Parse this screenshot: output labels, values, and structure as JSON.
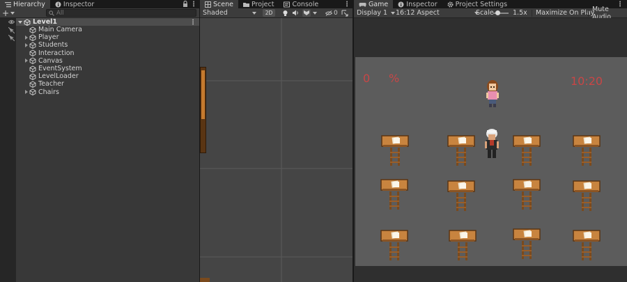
{
  "hierarchy": {
    "tabs": [
      {
        "label": "Hierarchy",
        "active": true
      },
      {
        "label": "Inspector",
        "active": false
      }
    ],
    "search_placeholder": "All",
    "root": "Level1",
    "items": [
      {
        "label": "Main Camera",
        "expandable": false
      },
      {
        "label": "Player",
        "expandable": true
      },
      {
        "label": "Students",
        "expandable": true
      },
      {
        "label": "Interaction",
        "expandable": false
      },
      {
        "label": "Canvas",
        "expandable": true
      },
      {
        "label": "EventSystem",
        "expandable": false
      },
      {
        "label": "LevelLoader",
        "expandable": false
      },
      {
        "label": "Teacher",
        "expandable": false
      },
      {
        "label": "Chairs",
        "expandable": true
      }
    ]
  },
  "scene": {
    "tabs": [
      {
        "label": "Scene",
        "active": true
      },
      {
        "label": "Project",
        "active": false
      },
      {
        "label": "Console",
        "active": false
      }
    ],
    "shading_mode": "Shaded",
    "mode_2d_label": "2D",
    "hidden_count": "0"
  },
  "game": {
    "tabs": [
      {
        "label": "Game",
        "active": true
      },
      {
        "label": "Inspector",
        "active": false
      },
      {
        "label": "Project Settings",
        "active": false
      }
    ],
    "display": "Display 1",
    "aspect": "16:12 Aspect",
    "scale_label": "Scale",
    "scale_value": "1.5x",
    "maximize_label": "Maximize On Play",
    "mute_label": "Mute Audio",
    "hud": {
      "score": "0",
      "percent": "%",
      "timer": "10:20"
    },
    "hud_color": "#c84646"
  },
  "colors": {
    "panel": "#383838",
    "toolbar": "#3c3c3c",
    "tab_bg": "#191919",
    "scene": "#454545",
    "game_bg": "#5c5c5c"
  }
}
